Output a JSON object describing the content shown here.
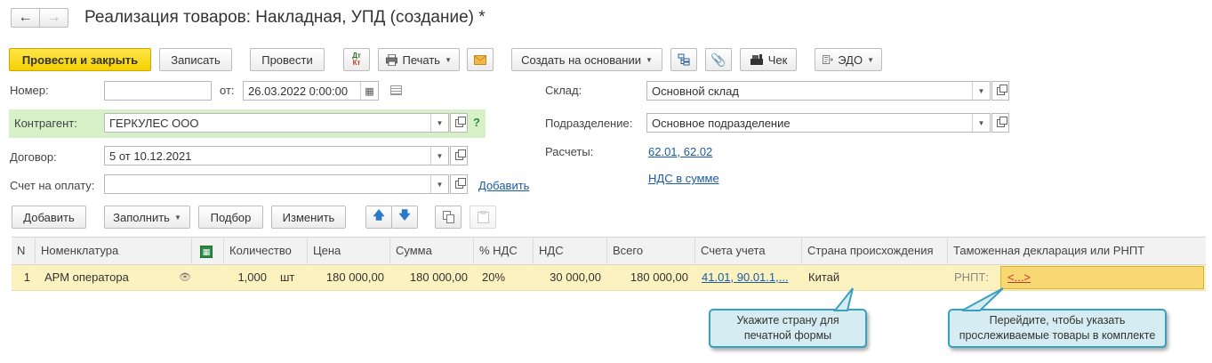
{
  "window": {
    "title": "Реализация товаров: Накладная, УПД (создание) *",
    "back_icon": "arrow-left-icon",
    "forward_icon": "arrow-right-icon"
  },
  "toolbar": {
    "post_close": "Провести и закрыть",
    "save": "Записать",
    "post": "Провести",
    "dtkt_dt": "Дт",
    "dtkt_kt": "Кт",
    "print": "Печать",
    "create_based": "Создать на основании",
    "receipt": "Чек",
    "edo": "ЭДО"
  },
  "form": {
    "number_label": "Номер:",
    "number_value": "",
    "date_label": "от:",
    "date_value": "26.03.2022  0:00:00",
    "counterparty_label": "Контрагент:",
    "counterparty_value": "ГЕРКУЛЕС ООО",
    "help": "?",
    "contract_label": "Договор:",
    "contract_value": "5 от 10.12.2021",
    "invoice_label": "Счет на оплату:",
    "invoice_value": "",
    "invoice_add": "Добавить",
    "warehouse_label": "Склад:",
    "warehouse_value": "Основной склад",
    "department_label": "Подразделение:",
    "department_value": "Основное подразделение",
    "settlements_label": "Расчеты:",
    "settlements_link": "62.01, 62.02",
    "vat_link": "НДС в сумме"
  },
  "table_toolbar": {
    "add": "Добавить",
    "fill": "Заполнить",
    "pick": "Подбор",
    "change": "Изменить"
  },
  "table": {
    "headers": [
      "N",
      "Номенклатура",
      "",
      "Количество",
      "Цена",
      "Сумма",
      "% НДС",
      "НДС",
      "Всего",
      "Счета учета",
      "Страна происхождения",
      "Таможенная декларация или РНПТ"
    ],
    "row": {
      "n": "1",
      "item": "АРМ оператора",
      "qty": "1,000",
      "unit": "шт",
      "price": "180 000,00",
      "sum": "180 000,00",
      "vat_rate": "20%",
      "vat": "30 000,00",
      "total": "180 000,00",
      "accounts": "41.01, 90.01.1,...",
      "country": "Китай",
      "rnpt_label": "РНПТ:",
      "rnpt_link": "<...>"
    }
  },
  "tooltips": {
    "country": "Укажите страну для печатной формы",
    "rnpt": "Перейдите, чтобы указать прослеживаемые товары в комплекте"
  },
  "colors": {
    "accent_yellow": "#f5d100",
    "row_highlight": "#fbf2c0",
    "counterparty_bg": "#d7f0c8",
    "link": "#1c5aa5",
    "tooltip_bg": "#d5ecf3"
  }
}
